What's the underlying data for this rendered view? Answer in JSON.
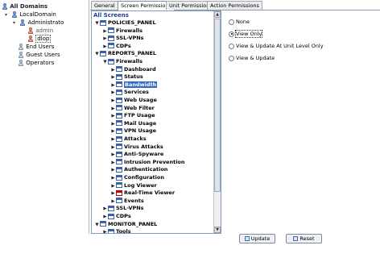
{
  "domain_tree": {
    "root": "All Domains",
    "domain": "LocalDomain",
    "group": "Administrato",
    "users": [
      "admin",
      "dlop"
    ],
    "end_users": "End Users",
    "guest_users": "Guest Users",
    "operators": "Operators"
  },
  "tabs": [
    {
      "label": "General",
      "active": false
    },
    {
      "label": "Screen Permissions",
      "active": true
    },
    {
      "label": "Unit Permissions",
      "active": false
    },
    {
      "label": "Action Permissions",
      "active": false
    }
  ],
  "screens": {
    "title": "All Screens",
    "items": [
      {
        "label": "POLICIES_PANEL",
        "level": 0,
        "expanded": true
      },
      {
        "label": "Firewalls",
        "level": 1,
        "expanded": false
      },
      {
        "label": "SSL-VPNs",
        "level": 1,
        "expanded": false
      },
      {
        "label": "CDPs",
        "level": 1,
        "expanded": false
      },
      {
        "label": "REPORTS_PANEL",
        "level": 0,
        "expanded": true
      },
      {
        "label": "Firewalls",
        "level": 1,
        "expanded": true
      },
      {
        "label": "Dashboard",
        "level": 2,
        "expanded": false
      },
      {
        "label": "Status",
        "level": 2,
        "expanded": false
      },
      {
        "label": "Bandwidth",
        "level": 2,
        "expanded": false,
        "selected": true
      },
      {
        "label": "Services",
        "level": 2,
        "expanded": false
      },
      {
        "label": "Web Usage",
        "level": 2,
        "expanded": false
      },
      {
        "label": "Web Filter",
        "level": 2,
        "expanded": false
      },
      {
        "label": "FTP Usage",
        "level": 2,
        "expanded": false
      },
      {
        "label": "Mail Usage",
        "level": 2,
        "expanded": false
      },
      {
        "label": "VPN Usage",
        "level": 2,
        "expanded": false
      },
      {
        "label": "Attacks",
        "level": 2,
        "expanded": false
      },
      {
        "label": "Virus Attacks",
        "level": 2,
        "expanded": false
      },
      {
        "label": "Anti-Spyware",
        "level": 2,
        "expanded": false
      },
      {
        "label": "Intrusion Prevention",
        "level": 2,
        "expanded": false
      },
      {
        "label": "Authentication",
        "level": 2,
        "expanded": false
      },
      {
        "label": "Configuration",
        "level": 2,
        "expanded": false
      },
      {
        "label": "Log Viewer",
        "level": 2,
        "expanded": false
      },
      {
        "label": "Real-Time Viewer",
        "level": 2,
        "expanded": false,
        "error_icon": true
      },
      {
        "label": "Events",
        "level": 2,
        "expanded": false
      },
      {
        "label": "SSL-VPNs",
        "level": 1,
        "expanded": false
      },
      {
        "label": "CDPs",
        "level": 1,
        "expanded": false
      },
      {
        "label": "MONITOR_PANEL",
        "level": 0,
        "expanded": true
      },
      {
        "label": "Tools",
        "level": 1,
        "expanded": false
      }
    ]
  },
  "permissions": {
    "options": [
      {
        "label": "None",
        "checked": false
      },
      {
        "label": "View Only",
        "checked": true
      },
      {
        "label": "View & Update At Unit Level Only",
        "checked": false
      },
      {
        "label": "View & Update",
        "checked": false
      }
    ]
  },
  "buttons": {
    "update": "Update",
    "reset": "Reset"
  }
}
